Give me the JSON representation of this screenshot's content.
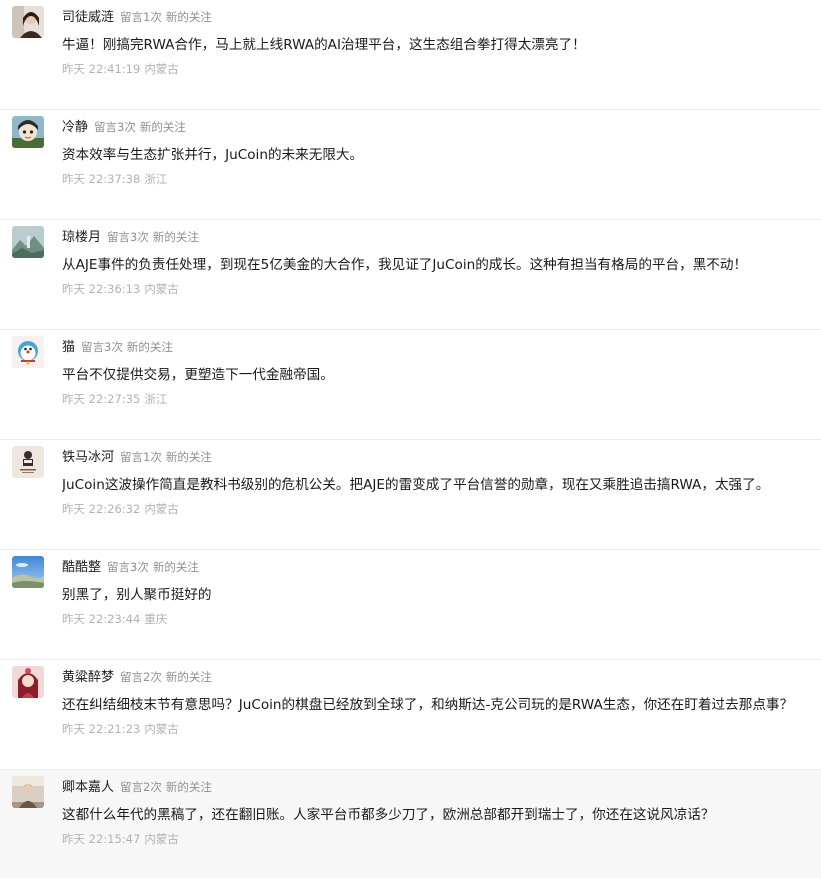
{
  "comments": [
    {
      "nickname": "司徒威涟",
      "reply_count": "留言1次",
      "follow_tag": "新的关注",
      "content": "牛逼！刚搞完RWA合作，马上就上线RWA的AI治理平台，这生态组合拳打得太漂亮了！",
      "time": "昨天 22:41:19",
      "location": "内蒙古",
      "avatar_icon": "portrait-avatar-icon",
      "avatar_colors": [
        "#e8e0d8",
        "#3a2a22"
      ]
    },
    {
      "nickname": "冷静",
      "reply_count": "留言3次",
      "follow_tag": "新的关注",
      "content": "资本效率与生态扩张并行，JuCoin的未来无限大。",
      "time": "昨天 22:37:38",
      "location": "浙江",
      "avatar_icon": "cartoon-avatar-icon",
      "avatar_colors": [
        "#8fb8c9",
        "#4a6b3a"
      ]
    },
    {
      "nickname": "琼楼月",
      "reply_count": "留言3次",
      "follow_tag": "新的关注",
      "content": "从AJE事件的负责任处理，到现在5亿美金的大合作，我见证了JuCoin的成长。这种有担当有格局的平台，黑不动！",
      "time": "昨天 22:36:13",
      "location": "内蒙古",
      "avatar_icon": "landscape-avatar-icon",
      "avatar_colors": [
        "#b9cdd0",
        "#4f6a5e"
      ]
    },
    {
      "nickname": "猫",
      "reply_count": "留言3次",
      "follow_tag": "新的关注",
      "content": "平台不仅提供交易，更塑造下一代金融帝国。",
      "time": "昨天 22:27:35",
      "location": "浙江",
      "avatar_icon": "cat-avatar-icon",
      "avatar_colors": [
        "#f6f1ef",
        "#c23b3b"
      ]
    },
    {
      "nickname": "铁马冰河",
      "reply_count": "留言1次",
      "follow_tag": "新的关注",
      "content": "JuCoin这波操作简直是教科书级别的危机公关。把AJE的雷变成了平台信誉的勋章，现在又乘胜追击搞RWA，太强了。",
      "time": "昨天 22:26:32",
      "location": "内蒙古",
      "avatar_icon": "figure-avatar-icon",
      "avatar_colors": [
        "#efe6df",
        "#3b2b2b"
      ]
    },
    {
      "nickname": "酷酷整",
      "reply_count": "留言3次",
      "follow_tag": "新的关注",
      "content": "别黑了，别人聚币挺好的",
      "time": "昨天 22:23:44",
      "location": "重庆",
      "avatar_icon": "sky-avatar-icon",
      "avatar_colors": [
        "#5f9be0",
        "#b7c4a8"
      ]
    },
    {
      "nickname": "黄粱醉梦",
      "reply_count": "留言2次",
      "follow_tag": "新的关注",
      "content": "还在纠结细枝末节有意思吗？JuCoin的棋盘已经放到全球了，和纳斯达-克公司玩的是RWA生态，你还在盯着过去那点事？",
      "time": "昨天 22:21:23",
      "location": "内蒙古",
      "avatar_icon": "woman-avatar-icon",
      "avatar_colors": [
        "#f2d9d9",
        "#8a1f2a"
      ]
    },
    {
      "nickname": "卿本嘉人",
      "reply_count": "留言2次",
      "follow_tag": "新的关注",
      "content": "这都什么年代的黑稿了，还在翻旧账。人家平台币都多少刀了，欧洲总部都开到瑞士了，你还在这说风凉话？",
      "time": "昨天 22:15:47",
      "location": "内蒙古",
      "avatar_icon": "room-avatar-icon",
      "avatar_colors": [
        "#d9cfc4",
        "#3d2f27"
      ]
    }
  ]
}
